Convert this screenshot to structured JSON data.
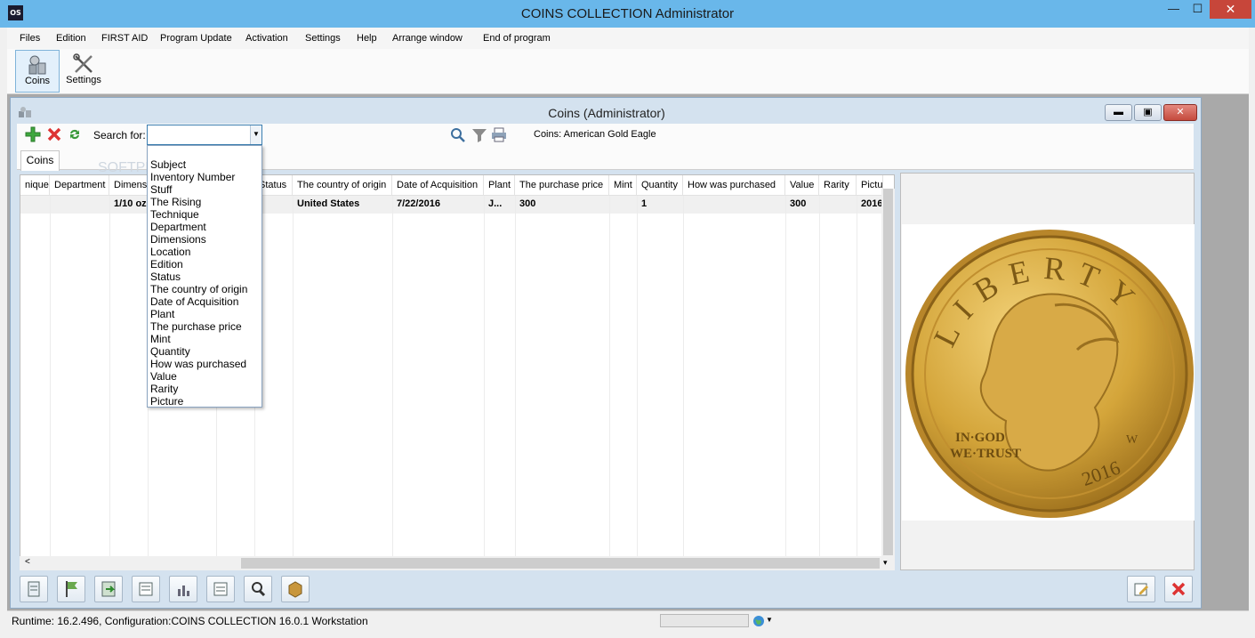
{
  "window": {
    "icon_text": "OS",
    "title": "COINS COLLECTION  Administrator",
    "min_glyph": "—",
    "max_glyph": "☐",
    "close_glyph": "✕"
  },
  "menu": [
    "Files",
    "Edition",
    "FIRST AID",
    "Program Update",
    "Activation",
    "Settings",
    "Help",
    "Arrange window",
    "End of program"
  ],
  "toolbar": {
    "coins_label": "Coins",
    "settings_label": "Settings"
  },
  "child": {
    "title": "Coins (Administrator)",
    "min_glyph": "▬",
    "max_glyph": "▣",
    "close_glyph": "✕",
    "search_label": "Search for:",
    "search_value": "",
    "record_label": "Coins: American Gold Eagle",
    "tab_label": "Coins",
    "watermark": "SOFTPEDIA"
  },
  "grid": {
    "columns": [
      "nique",
      "Department",
      "Dimensi",
      "",
      "",
      "Status",
      "The country of origin",
      "Date of Acquisition",
      "Plant",
      "The purchase price",
      "Mint",
      "Quantity",
      "How was purchased",
      "Value",
      "Rarity",
      "Pictu"
    ],
    "row": [
      "",
      "",
      "1/10 oz",
      "",
      "",
      "",
      "United States",
      "7/22/2016",
      "J...",
      "300",
      "",
      "1",
      "",
      "300",
      "",
      "2016"
    ]
  },
  "dropdown": [
    "Subject",
    "Inventory Number",
    "Stuff",
    "The Rising",
    "Technique",
    "Department",
    "Dimensions",
    "Location",
    "Edition",
    "Status",
    "The country of origin",
    "Date of Acquisition",
    "Plant",
    "The purchase price",
    "Mint",
    "Quantity",
    "How was purchased",
    "Value",
    "Rarity",
    "Picture"
  ],
  "coin": {
    "top_text": "LIBERTY",
    "motto_1": "IN·GOD",
    "motto_2": "WE·TRUST",
    "year": "2016",
    "mintmark": "W",
    "gold": "#d4a53a"
  },
  "status": {
    "text": "Runtime: 16.2.496, Configuration:COINS COLLECTION 16.0.1 Workstation"
  },
  "colors": {
    "titlebar": "#69b7ea",
    "close": "#c7463a",
    "child_bg": "#d4e2ef"
  }
}
